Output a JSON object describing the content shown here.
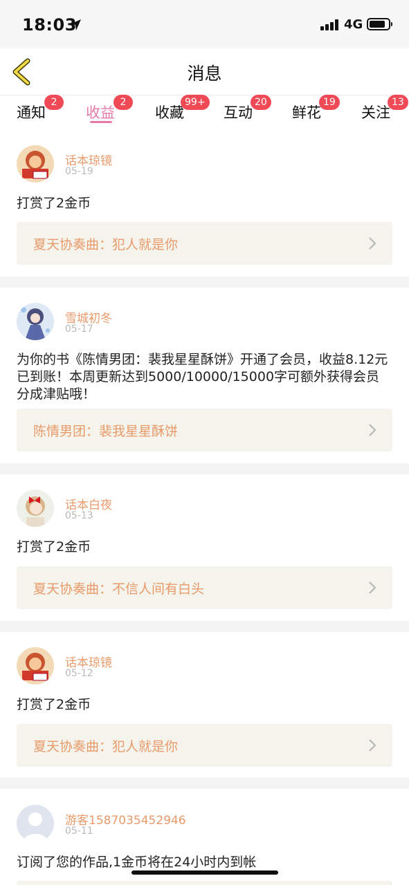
{
  "status_bar": {
    "time": "18:03",
    "network": "4G",
    "battery_level": 0.85
  },
  "header": {
    "title": "消息"
  },
  "tabs": [
    {
      "label": "通知",
      "badge": "2"
    },
    {
      "label": "收益",
      "badge": "2",
      "active": true
    },
    {
      "label": "收藏",
      "badge": "99+"
    },
    {
      "label": "互动",
      "badge": "20"
    },
    {
      "label": "鲜花",
      "badge": "19"
    },
    {
      "label": "关注",
      "badge": "13"
    }
  ],
  "colors": {
    "accent": "#e77aa6",
    "badge": "#f04a57",
    "username": "#e89a6a",
    "link_bg": "#f5f4ec"
  },
  "messages": [
    {
      "user": "话本琼镜",
      "date": "05-19",
      "text": "打赏了2金币",
      "link": "夏天协奏曲：犯人就是你",
      "avatar": "cartoon-avatar"
    },
    {
      "user": "雪城初冬",
      "date": "05-17",
      "text": "为你的书《陈情男团：裴我星星酥饼》开通了会员，收益8.12元已到账！本周更新达到5000/10000/15000字可额外获得会员分成津贴哦！",
      "link": "陈情男团：裴我星星酥饼",
      "avatar": "anime-avatar"
    },
    {
      "user": "话本白夜",
      "date": "05-13",
      "text": "打赏了2金币",
      "link": "夏天协奏曲：不信人间有白头",
      "avatar": "doll-avatar"
    },
    {
      "user": "话本琼镜",
      "date": "05-12",
      "text": "打赏了2金币",
      "link": "夏天协奏曲：犯人就是你",
      "avatar": "cartoon-avatar"
    },
    {
      "user": "游客1587035452946",
      "date": "05-11",
      "text": "订阅了您的作品,1金币将在24小时内到帐",
      "avatar": "default-avatar"
    }
  ]
}
